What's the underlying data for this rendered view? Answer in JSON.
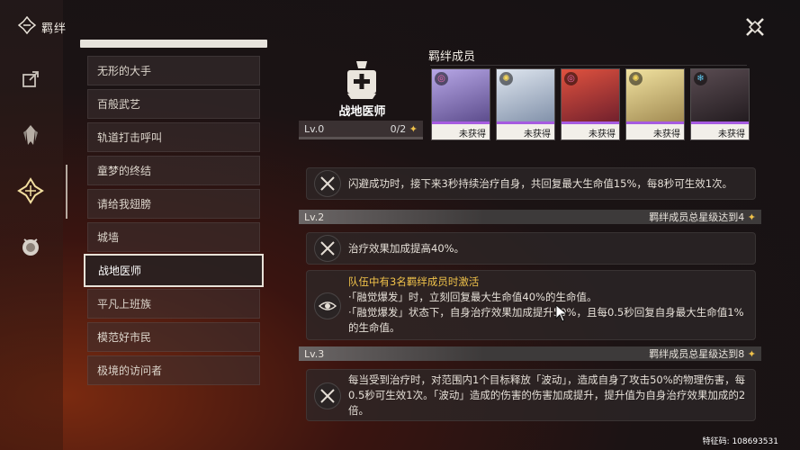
{
  "header": {
    "title": "羁绊"
  },
  "sidebar": {
    "items": [
      {
        "name": "export-icon"
      },
      {
        "name": "character-icon"
      },
      {
        "name": "bond-icon",
        "active": true
      },
      {
        "name": "orb-icon"
      }
    ]
  },
  "bond_list": [
    {
      "label": "无形的大手"
    },
    {
      "label": "百般武艺"
    },
    {
      "label": "轨道打击呼叫"
    },
    {
      "label": "童梦的终结"
    },
    {
      "label": "请给我翅膀"
    },
    {
      "label": "城墙"
    },
    {
      "label": "战地医师",
      "active": true
    },
    {
      "label": "平凡上班族"
    },
    {
      "label": "模范好市民"
    },
    {
      "label": "极境的访问者"
    }
  ],
  "bond": {
    "name": "战地医师",
    "level": "Lv.0",
    "progress": "0/2"
  },
  "members": {
    "label": "羁绊成员",
    "cards": [
      {
        "status": "未获得",
        "element": "pink",
        "bg": "#5a4a8a"
      },
      {
        "status": "未获得",
        "element": "yellow",
        "bg": "#8a9ab0"
      },
      {
        "status": "未获得",
        "element": "pink",
        "bg": "#8a2a3a"
      },
      {
        "status": "未获得",
        "element": "yellow",
        "bg": "#b0a060"
      },
      {
        "status": "未获得",
        "element": "blue",
        "bg": "#3a3034"
      }
    ]
  },
  "effects": {
    "e1": "闪避成功时，接下来3秒持续治疗自身，共回复最大生命值15%，每8秒可生效1次。",
    "lv2": {
      "level": "Lv.2",
      "requirement": "羁绊成员总星级达到4"
    },
    "e2": "治疗效果加成提高40%。",
    "e3": {
      "title": "队伍中有3名羁绊成员时激活",
      "line1": "·「融觉爆发」时，立刻回复最大生命值40%的生命值。",
      "line2": "·「融觉爆发」状态下，自身治疗效果加成提升50%，且每0.5秒回复自身最大生命值1%的生命值。"
    },
    "lv3": {
      "level": "Lv.3",
      "requirement": "羁绊成员总星级达到8"
    },
    "e4": "每当受到治疗时，对范围内1个目标释放「波动」，造成自身了攻击50%的物理伤害，每0.5秒可生效1次。「波动」造成的伤害的伤害加成提升，提升值为自身治疗效果加成的2倍。"
  },
  "footer": {
    "feature_code": "特征码: 108693531"
  },
  "colors": {
    "accent": "#f0c24a",
    "rarity": "#a65be0"
  }
}
